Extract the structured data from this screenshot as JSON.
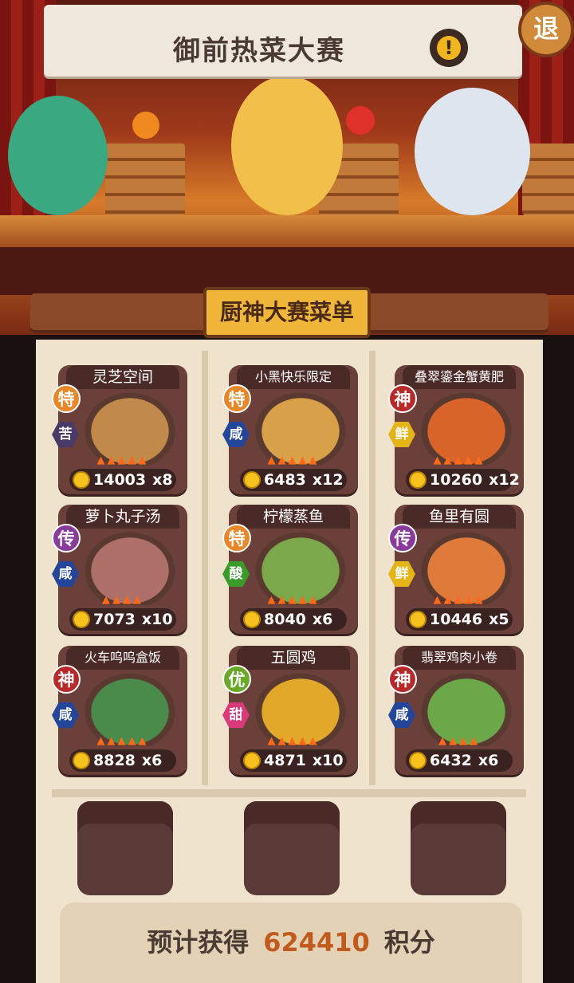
{
  "header": {
    "title": "御前热菜大赛",
    "alert_glyph": "!",
    "exit_label": "退"
  },
  "menu": {
    "title": "厨神大赛菜单",
    "dishes": [
      {
        "name": "灵芝空间",
        "rank": "特",
        "taste": "苦",
        "flames": 5,
        "price": "14003",
        "count": "x8",
        "rank_color": "#e8872a",
        "taste_color": "#4a3a6a"
      },
      {
        "name": "小黑快乐限定",
        "rank": "特",
        "taste": "咸",
        "flames": 5,
        "price": "6483",
        "count": "x12",
        "rank_color": "#e8872a",
        "taste_color": "#23469a"
      },
      {
        "name": "叠翠鎏金蟹黄肥",
        "rank": "神",
        "taste": "鲜",
        "flames": 5,
        "price": "10260",
        "count": "x12",
        "rank_color": "#b82a2a",
        "taste_color": "#e5b416"
      },
      {
        "name": "萝卜丸子汤",
        "rank": "传",
        "taste": "咸",
        "flames": 4,
        "price": "7073",
        "count": "x10",
        "rank_color": "#8a3a9a",
        "taste_color": "#23469a"
      },
      {
        "name": "柠檬蒸鱼",
        "rank": "特",
        "taste": "酸",
        "flames": 5,
        "price": "8040",
        "count": "x6",
        "rank_color": "#e8872a",
        "taste_color": "#3a9a2a"
      },
      {
        "name": "鱼里有圆",
        "rank": "传",
        "taste": "鲜",
        "flames": 5,
        "price": "10446",
        "count": "x5",
        "rank_color": "#8a3a9a",
        "taste_color": "#e5b416"
      },
      {
        "name": "火车呜呜盒饭",
        "rank": "神",
        "taste": "咸",
        "flames": 5,
        "price": "8828",
        "count": "x6",
        "rank_color": "#b82a2a",
        "taste_color": "#23469a"
      },
      {
        "name": "五圆鸡",
        "rank": "优",
        "taste": "甜",
        "flames": 5,
        "price": "4871",
        "count": "x10",
        "rank_color": "#6aa82a",
        "taste_color": "#d83a7a"
      },
      {
        "name": "翡翠鸡肉小卷",
        "rank": "神",
        "taste": "咸",
        "flames": 4,
        "price": "6432",
        "count": "x6",
        "rank_color": "#b82a2a",
        "taste_color": "#23469a"
      }
    ]
  },
  "summary": {
    "prefix": "预计获得",
    "points": "624410",
    "suffix": "积分"
  },
  "colors": {
    "accent_orange": "#c25a1e",
    "paper": "#efe3cd",
    "card": "#6b3f3a",
    "coin": "#f7c21e"
  },
  "icons": [
    "alert-icon",
    "exit-button",
    "coin-icon",
    "flame-icon"
  ]
}
